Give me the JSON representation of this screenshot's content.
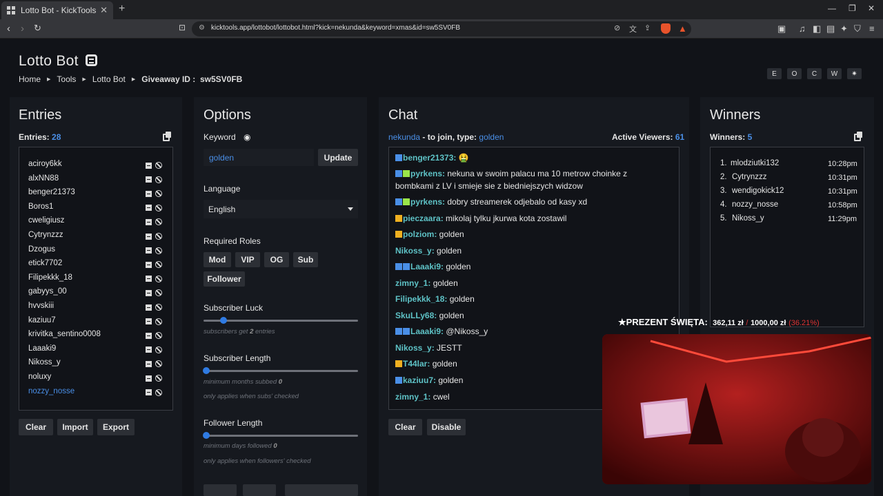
{
  "browser": {
    "tab_title": "Lotto Bot - KickTools",
    "url": "kicktools.app/lottobot/lottobot.html?kick=nekunda&keyword=xmas&id=sw5SV0FB"
  },
  "header": {
    "title": "Lotto Bot",
    "breadcrumbs": [
      "Home",
      "Tools",
      "Lotto Bot"
    ],
    "giveaway_label": "Giveaway ID :",
    "giveaway_id": "sw5SV0FB",
    "top_buttons": [
      "E",
      "O",
      "C",
      "W",
      "✷"
    ]
  },
  "entries": {
    "title": "Entries",
    "count_label": "Entries:",
    "count": "28",
    "list": [
      "aciroy6kk",
      "alxNN88",
      "benger21373",
      "Boros1",
      "cweligiusz",
      "Cytrynzzz",
      "Dzogus",
      "etick7702",
      "Filipekkk_18",
      "gabyys_00",
      "hvvskiii",
      "kaziuu7",
      "krivitka_sentino0008",
      "Laaaki9",
      "Nikoss_y",
      "noluxy",
      "nozzy_nosse"
    ],
    "buttons": [
      "Clear",
      "Import",
      "Export"
    ]
  },
  "options": {
    "title": "Options",
    "keyword_label": "Keyword",
    "keyword_value": "golden",
    "update_label": "Update",
    "language_label": "Language",
    "language_value": "English",
    "roles_label": "Required Roles",
    "roles": [
      "Mod",
      "VIP",
      "OG",
      "Sub",
      "Follower"
    ],
    "sub_luck_label": "Subscriber Luck",
    "sub_luck_hint_pre": "subscribers get",
    "sub_luck_value": "2",
    "sub_luck_hint_post": "entries",
    "sub_length_label": "Subscriber Length",
    "sub_length_hint_pre": "minimum months subbed",
    "sub_length_value": "0",
    "sub_length_note": "only applies when subs' checked",
    "follow_length_label": "Follower Length",
    "follow_length_hint_pre": "minimum days followed",
    "follow_length_value": "0",
    "follow_length_note": "only applies when followers' checked"
  },
  "chat": {
    "title": "Chat",
    "channel": "nekunda",
    "join_text": "- to join, type:",
    "keyword": "golden",
    "viewers_label": "Active Viewers:",
    "viewers": "61",
    "messages": [
      {
        "user": "benger21373:",
        "text": "🤮"
      },
      {
        "user": "pyrkens:",
        "text": "nekuna w swoim palacu ma 10 metrow choinke z"
      },
      {
        "user": "",
        "text": "bombkami z LV i smieje sie z biedniejszych widzow"
      },
      {
        "user": "pyrkens:",
        "text": "dobry streamerek odjebalo od kasy xd"
      },
      {
        "user": "pieczaara:",
        "text": "mikolaj tylku jkurwa kota zostawil"
      },
      {
        "user": "polziom:",
        "text": "golden"
      },
      {
        "user": "Nikoss_y:",
        "text": "golden"
      },
      {
        "user": "Laaaki9:",
        "text": "golden"
      },
      {
        "user": "zimny_1:",
        "text": "golden"
      },
      {
        "user": "Filipekkk_18:",
        "text": "golden"
      },
      {
        "user": "SkuLLy68:",
        "text": "golden"
      },
      {
        "user": "Laaaki9:",
        "text": "@Nikoss_y"
      },
      {
        "user": "Nikoss_y:",
        "text": "JESTT"
      },
      {
        "user": "T44lar:",
        "text": "golden"
      },
      {
        "user": "kaziuu7:",
        "text": "golden"
      },
      {
        "user": "zimny_1:",
        "text": "cwel"
      }
    ],
    "buttons": [
      "Clear",
      "Disable"
    ]
  },
  "winners": {
    "title": "Winners",
    "count_label": "Winners:",
    "count": "5",
    "list": [
      {
        "rank": "1.",
        "name": "mlodziutki132",
        "time": "10:28pm"
      },
      {
        "rank": "2.",
        "name": "Cytrynzzz",
        "time": "10:31pm"
      },
      {
        "rank": "3.",
        "name": "wendigokick12",
        "time": "10:31pm"
      },
      {
        "rank": "4.",
        "name": "nozzy_nosse",
        "time": "10:58pm"
      },
      {
        "rank": "5.",
        "name": "Nikoss_y",
        "time": "11:29pm"
      }
    ]
  },
  "stream_overlay": {
    "label": "★PREZENT ŚWIĘTA:",
    "amount": "362,11 zł",
    "sep": "/",
    "goal": "1000,00 zł",
    "percent": "(36.21%)"
  },
  "colors": {
    "accent": "#4a8fe7",
    "username": "#5ec2c6",
    "background": "#111318",
    "panel": "#16191f"
  }
}
